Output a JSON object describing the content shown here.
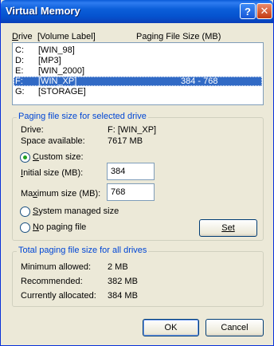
{
  "window": {
    "title": "Virtual Memory",
    "help_glyph": "?",
    "close_glyph": "✕"
  },
  "drive_list": {
    "header_drive": "Drive",
    "header_label": "[Volume Label]",
    "header_paging": "Paging File Size (MB)",
    "rows": [
      {
        "drive": "C:",
        "label": "[WIN_98]",
        "size": ""
      },
      {
        "drive": "D:",
        "label": "[MP3]",
        "size": ""
      },
      {
        "drive": "E:",
        "label": "[WIN_2000]",
        "size": ""
      },
      {
        "drive": "F:",
        "label": "[WIN_XP]",
        "size": "384 - 768",
        "selected": true
      },
      {
        "drive": "G:",
        "label": "[STORAGE]",
        "size": ""
      }
    ]
  },
  "selected_drive": {
    "group_title": "Paging file size for selected drive",
    "drive_label": "Drive:",
    "drive_value": "F:  [WIN_XP]",
    "space_label": "Space available:",
    "space_value": "7617 MB",
    "custom_size": "Custom size:",
    "initial_label": "Initial size (MB):",
    "initial_value": "384",
    "maximum_label": "Maximum size (MB):",
    "maximum_value": "768",
    "system_managed": "System managed size",
    "no_paging": "No paging file",
    "set_button": "Set"
  },
  "all_drives": {
    "group_title": "Total paging file size for all drives",
    "min_label": "Minimum allowed:",
    "min_value": "2 MB",
    "rec_label": "Recommended:",
    "rec_value": "382 MB",
    "cur_label": "Currently allocated:",
    "cur_value": "384 MB"
  },
  "buttons": {
    "ok": "OK",
    "cancel": "Cancel"
  }
}
